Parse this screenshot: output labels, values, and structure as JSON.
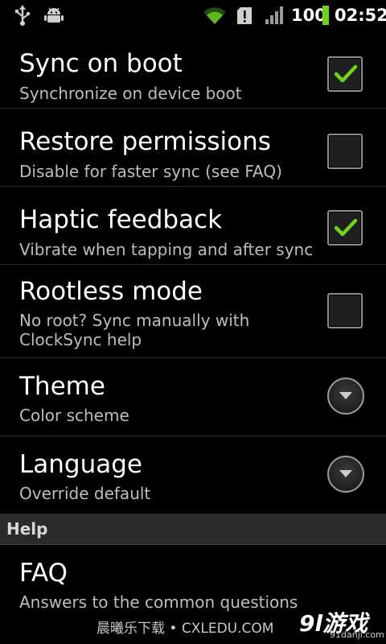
{
  "status_bar": {
    "icons": [
      "usb-icon",
      "android-debug-icon",
      "wifi-icon",
      "sd-card-alert-icon",
      "signal-icon",
      "battery-icon"
    ],
    "battery_level": "100",
    "time": "02:52",
    "accent_color": "#6fd31e"
  },
  "preferences": [
    {
      "title": "Sync on boot",
      "summary": "Synchronize on device boot",
      "widget": "checkbox",
      "checked": true
    },
    {
      "title": "Restore permissions",
      "summary": "Disable for faster sync (see FAQ)",
      "widget": "checkbox",
      "checked": false
    },
    {
      "title": "Haptic feedback",
      "summary": "Vibrate when tapping and after sync",
      "widget": "checkbox",
      "checked": true
    },
    {
      "title": "Rootless mode",
      "summary": "No root? Sync manually with ClockSync help",
      "widget": "checkbox",
      "checked": false
    },
    {
      "title": "Theme",
      "summary": "Color scheme",
      "widget": "dropdown"
    },
    {
      "title": "Language",
      "summary": "Override default",
      "widget": "dropdown"
    }
  ],
  "help_category": {
    "label": "Help"
  },
  "help_items": [
    {
      "title": "FAQ",
      "summary": "Answers to the common questions"
    }
  ],
  "watermark": {
    "text": "晨曦乐下载 • CXLEDU.COM",
    "logo": "9l游戏",
    "url": "91danji.com"
  }
}
